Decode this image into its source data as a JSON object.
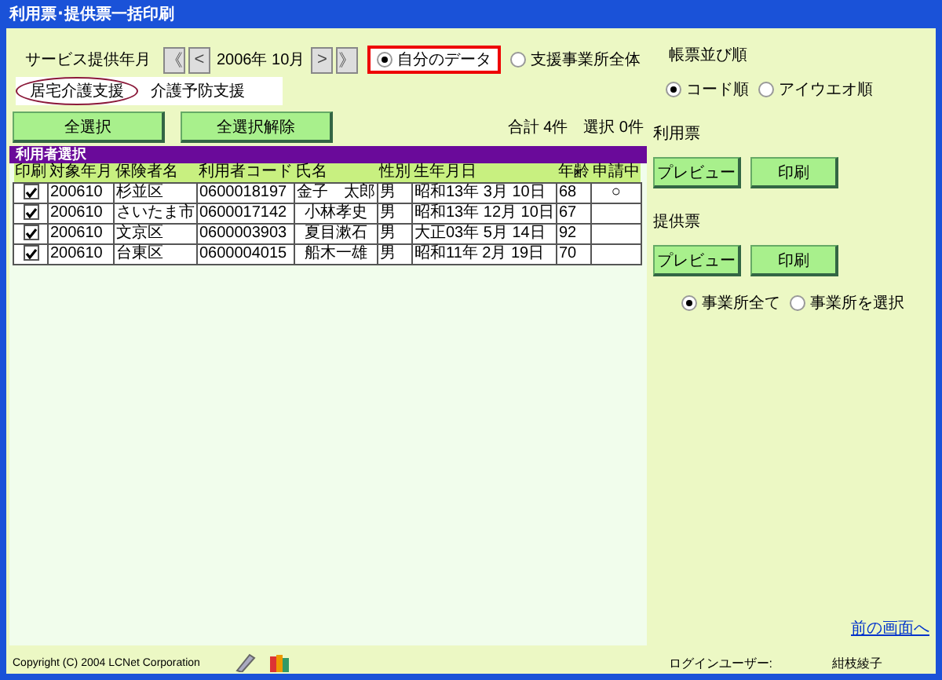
{
  "window": {
    "title": "利用票･提供票一括印刷"
  },
  "period": {
    "label": "サービス提供年月",
    "first": "《",
    "prev": "<",
    "value": "2006年 10月",
    "next": ">",
    "last": "》"
  },
  "scope": [
    {
      "label": "自分のデータ",
      "selected": true
    },
    {
      "label": "支援事業所全体",
      "selected": false
    }
  ],
  "tabs": [
    {
      "label": "居宅介護支援",
      "selected": true
    },
    {
      "label": "介護予防支援",
      "selected": false
    }
  ],
  "buttons": [
    "全選択",
    "全選択解除"
  ],
  "summary": {
    "total": "合計 4件",
    "selected": "選択 0件"
  },
  "table": {
    "title": "利用者選択",
    "columns": [
      "印刷",
      "対象年月",
      "保険者名",
      "利用者コード",
      "氏名",
      "性別",
      "生年月日",
      "年齢",
      "申請中"
    ],
    "rows": [
      {
        "checked": true,
        "cells": [
          "",
          "200610",
          "杉並区",
          "0600018197",
          "金子　太郎",
          "男",
          "昭和13年 3月 10日",
          "68",
          "○"
        ]
      },
      {
        "checked": true,
        "cells": [
          "",
          "200610",
          "さいたま市",
          "0600017142",
          "小林孝史",
          "男",
          "昭和13年 12月 10日",
          "67",
          ""
        ]
      },
      {
        "checked": true,
        "cells": [
          "",
          "200610",
          "文京区",
          "0600003903",
          "夏目漱石",
          "男",
          "大正03年 5月 14日",
          "92",
          ""
        ]
      },
      {
        "checked": true,
        "cells": [
          "",
          "200610",
          "台東区",
          "0600004015",
          "船木一雄",
          "男",
          "昭和11年 2月 19日",
          "70",
          ""
        ]
      }
    ]
  },
  "sort": {
    "label": "帳票並び順",
    "options": [
      {
        "label": "コード順",
        "selected": true
      },
      {
        "label": "アイウエオ順",
        "selected": false
      }
    ]
  },
  "usage": {
    "label": "利用票",
    "preview": "プレビュー",
    "print": "印刷"
  },
  "provision": {
    "label": "提供票",
    "preview": "プレビュー",
    "print": "印刷"
  },
  "offices": [
    {
      "label": "事業所全て",
      "selected": true
    },
    {
      "label": "事業所を選択",
      "selected": false
    }
  ],
  "back_link": "前の画面へ",
  "footer": {
    "copyright": "Copyright (C) 2004 LCNet Corporation",
    "user_label": "ログインユーザー:",
    "user": "紺枝綾子"
  }
}
